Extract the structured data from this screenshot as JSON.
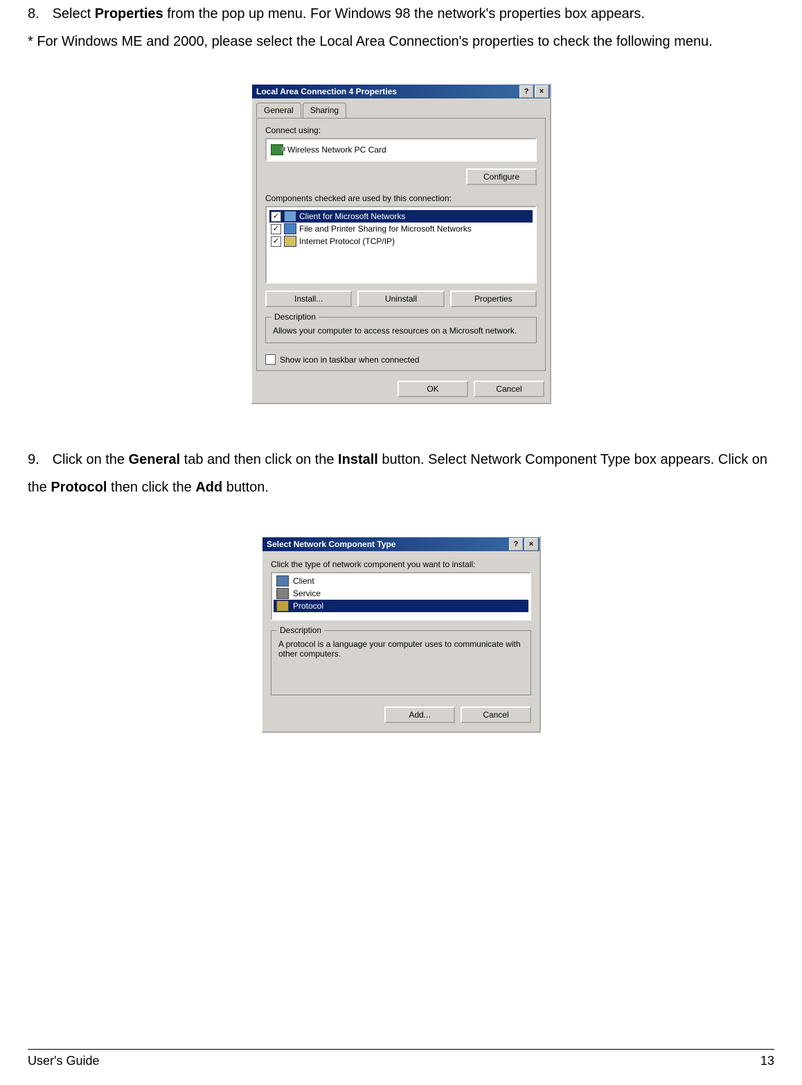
{
  "step8": {
    "num": "8.",
    "text_a": "Select ",
    "bold_a": "Properties",
    "text_b": " from the pop up menu. For Windows 98 the network's properties box appears.",
    "note": "* For Windows ME and 2000, please select the Local Area Connection's properties to check the following menu."
  },
  "dialog1": {
    "title": "Local Area Connection 4 Properties",
    "help_btn": "?",
    "close_btn": "×",
    "tabs": {
      "general": "General",
      "sharing": "Sharing"
    },
    "connect_using_label": "Connect using:",
    "adapter": "Wireless Network PC Card",
    "configure_btn": "Configure",
    "components_label": "Components checked are used by this connection:",
    "components": [
      {
        "label": "Client for Microsoft Networks",
        "selected": true
      },
      {
        "label": "File and Printer Sharing for Microsoft Networks",
        "selected": false
      },
      {
        "label": "Internet Protocol (TCP/IP)",
        "selected": false
      }
    ],
    "install_btn": "Install...",
    "uninstall_btn": "Uninstall",
    "properties_btn": "Properties",
    "description_legend": "Description",
    "description_text": "Allows your computer to access resources on a Microsoft network.",
    "show_icon": "Show icon in taskbar when connected",
    "ok_btn": "OK",
    "cancel_btn": "Cancel"
  },
  "step9": {
    "num": "9.",
    "t1": "Click on the ",
    "b1": "General",
    "t2": " tab and then click on the ",
    "b2": "Install",
    "t3": " button. Select Network Component Type box appears. Click on the ",
    "b3": "Protocol",
    "t4": " then click the ",
    "b4": "Add",
    "t5": " button."
  },
  "dialog2": {
    "title": "Select Network Component Type",
    "help_btn": "?",
    "close_btn": "×",
    "prompt": "Click the type of network component you want to install:",
    "types": [
      {
        "label": "Client",
        "cls": "client",
        "selected": false
      },
      {
        "label": "Service",
        "cls": "service",
        "selected": false
      },
      {
        "label": "Protocol",
        "cls": "protocol",
        "selected": true
      }
    ],
    "description_legend": "Description",
    "description_text": "A protocol is a language your computer uses to communicate with other computers.",
    "add_btn": "Add...",
    "cancel_btn": "Cancel"
  },
  "footer": {
    "left": "User's Guide",
    "right": "13"
  }
}
